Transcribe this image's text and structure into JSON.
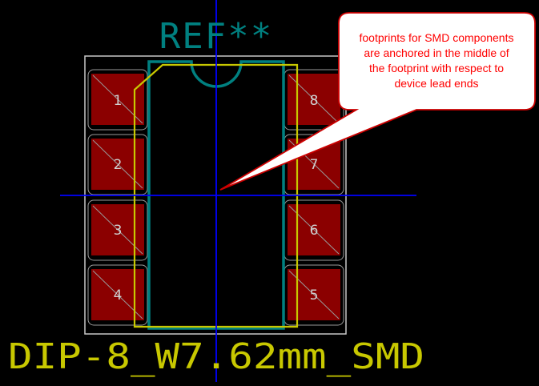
{
  "footprint": {
    "reference": "REF**",
    "value": "DIP-8_W7.62mm_SMD"
  },
  "pads": {
    "left": [
      "1",
      "2",
      "3",
      "4"
    ],
    "right": [
      "8",
      "7",
      "6",
      "5"
    ]
  },
  "callout": {
    "lines": [
      "footprints for SMD components",
      "are anchored in the middle of",
      "the footprint with respect to",
      "device lead ends"
    ]
  },
  "colors": {
    "background": "#000000",
    "pad_fill": "#8b0000",
    "pad_outline": "#9a9a9a",
    "courtyard": "#c8c8c8",
    "silkscreen": "#c8c800",
    "fab_outline": "#008080",
    "reference_text": "#008080",
    "value_text": "#c8c800",
    "anchor_axis": "#0000ff",
    "callout_fill": "#ffffff",
    "callout_border": "#cc0000",
    "callout_text": "#ff0000"
  }
}
